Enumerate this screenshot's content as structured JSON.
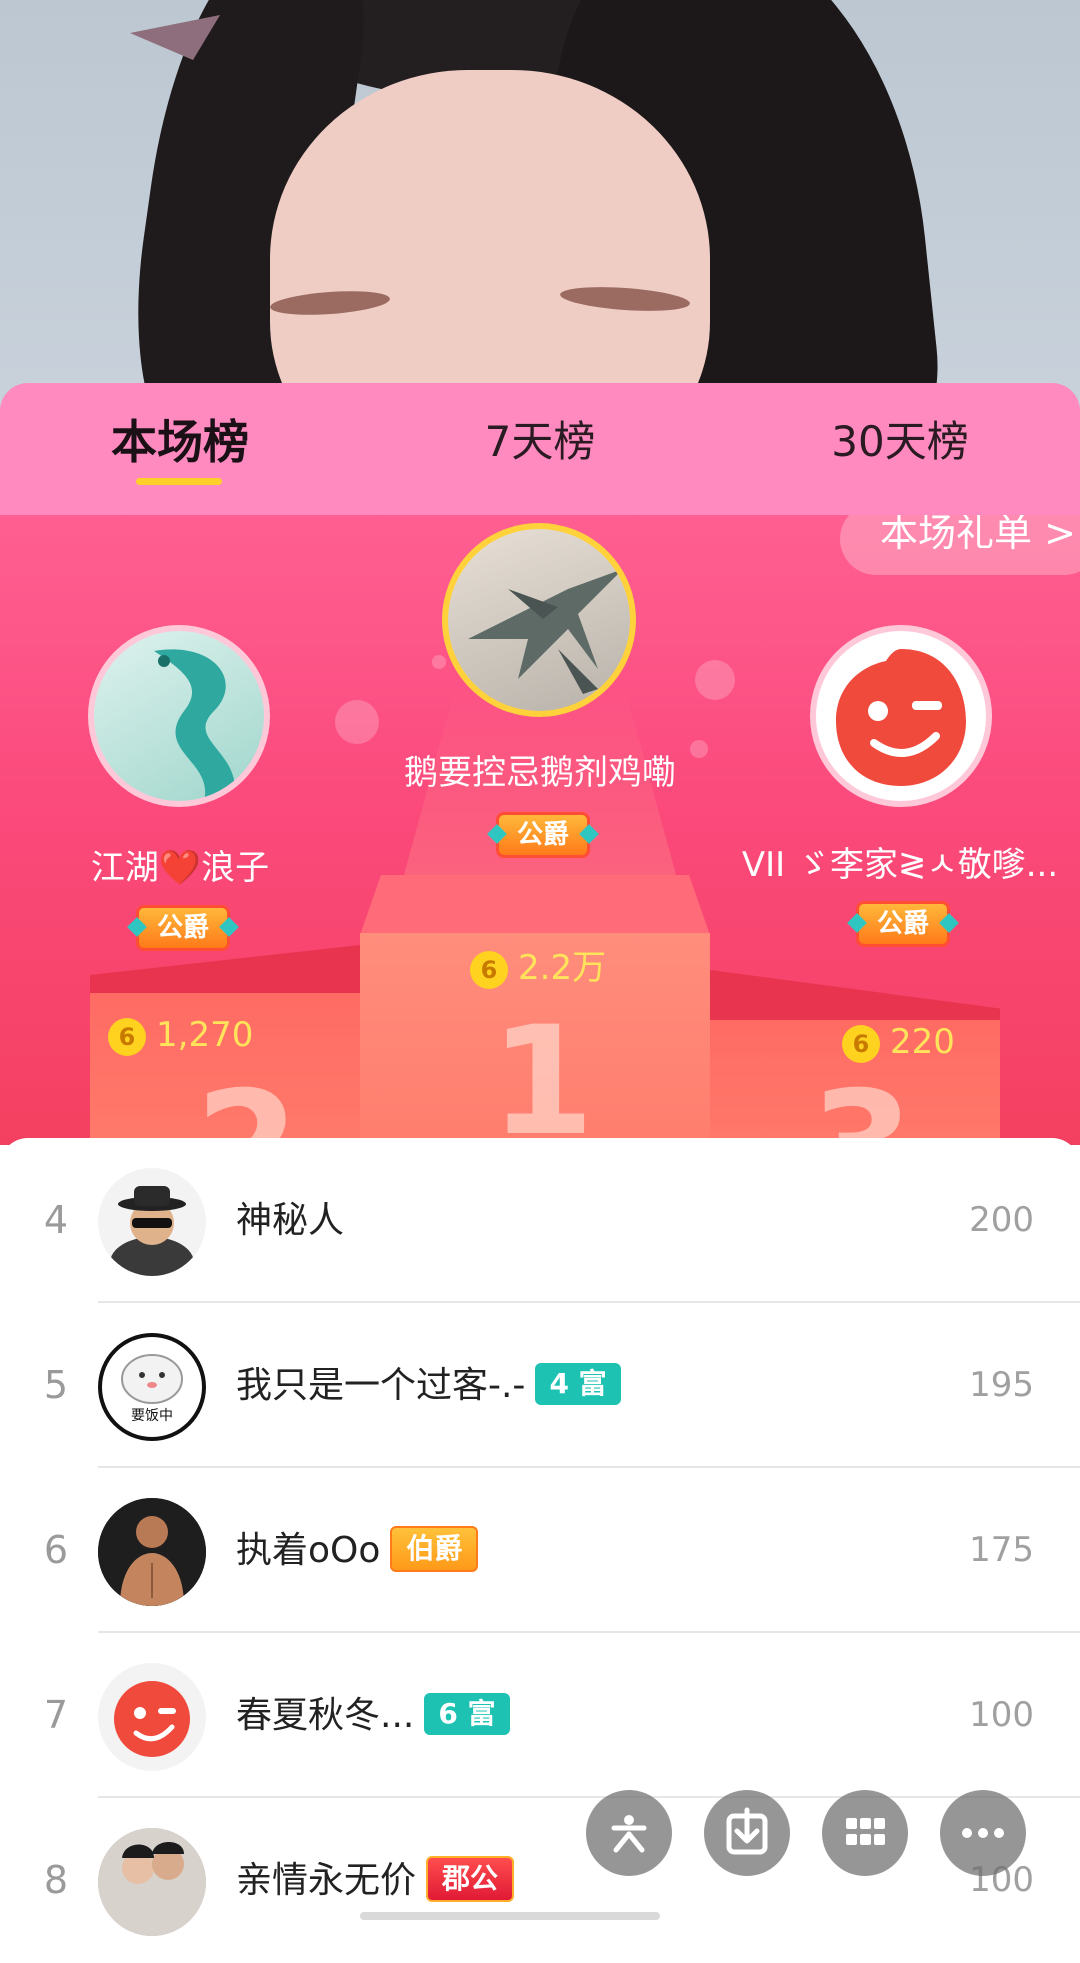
{
  "tabs": [
    {
      "label": "本场榜"
    },
    {
      "label": "7天榜"
    },
    {
      "label": "30天榜"
    }
  ],
  "gift_list_button": "本场礼单 >",
  "podium": {
    "first": {
      "rank": "1",
      "name": "鹅要控忌鹅剂鸡嘞",
      "title": "公爵",
      "score": "2.2万"
    },
    "second": {
      "rank": "2",
      "name": "江湖❤️浪子",
      "title": "公爵",
      "score": "1,270"
    },
    "third": {
      "rank": "3",
      "name": "VII ゞ李家≷ㅅ敬嗲...",
      "title": "公爵",
      "score": "220"
    }
  },
  "coin_symbol": "6",
  "list": [
    {
      "rank": "4",
      "name": "神秘人",
      "tag": "",
      "value": "200",
      "avatar": "mystery-person-avatar"
    },
    {
      "rank": "5",
      "name": "我只是一个过客-.-",
      "tag": "4 富",
      "value": "195",
      "avatar": "hamster-avatar",
      "avatar_text": "要饭中"
    },
    {
      "rank": "6",
      "name": "执着oOo",
      "tag": "伯爵",
      "value": "175",
      "avatar": "muscle-man-avatar"
    },
    {
      "rank": "7",
      "name": "春夏秋冬...",
      "tag": "6 富",
      "value": "100",
      "avatar": "red-wink-avatar"
    },
    {
      "rank": "8",
      "name": "亲情永无价",
      "tag": "郡公",
      "value": "100",
      "avatar": "couple-avatar"
    }
  ],
  "fab": [
    {
      "icon": "sparkle-icon"
    },
    {
      "icon": "download-icon"
    },
    {
      "icon": "grid-icon"
    },
    {
      "icon": "more-icon"
    }
  ],
  "colors": {
    "tab_bg": "#ff8ac0",
    "podium_bg": "#fb4a7c",
    "score_yellow": "#ffe35a",
    "rich_tag": "#1dc2b3",
    "underline": "#ffd02a"
  }
}
